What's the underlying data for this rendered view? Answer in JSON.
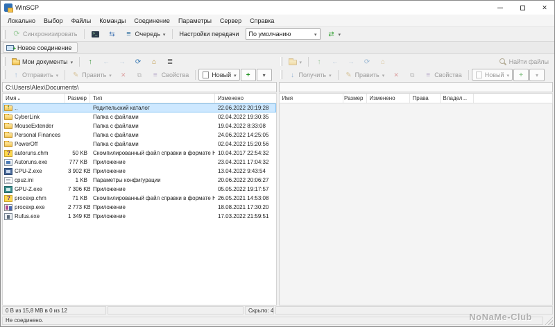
{
  "window": {
    "title": "WinSCP"
  },
  "menu": {
    "items": [
      "Локально",
      "Выбор",
      "Файлы",
      "Команды",
      "Соединение",
      "Параметры",
      "Сервер",
      "Справка"
    ]
  },
  "toolbar": {
    "synchronize": "Синхронизировать",
    "queue": "Очередь",
    "transfer_settings_label": "Настройки передачи",
    "transfer_preset": "По умолчанию"
  },
  "tabs": {
    "new_session": "Новое соединение"
  },
  "left": {
    "drive": "Мои документы",
    "upload": "Отправить",
    "edit": "Править",
    "properties": "Свойства",
    "new": "Новый",
    "address": "C:\\Users\\Alex\\Documents\\",
    "columns": {
      "name": "Имя",
      "size": "Размер",
      "type": "Тип",
      "modified": "Изменено"
    },
    "files": [
      {
        "name": "..",
        "size": "",
        "type": "Родительский каталог",
        "modified": "22.06.2022 20:19:28",
        "icon": "folder-up"
      },
      {
        "name": "CyberLink",
        "size": "",
        "type": "Папка с файлами",
        "modified": "02.04.2022 19:30:35",
        "icon": "folder"
      },
      {
        "name": "MouseExtender",
        "size": "",
        "type": "Папка с файлами",
        "modified": "19.04.2022 8:33:08",
        "icon": "folder"
      },
      {
        "name": "Personal Finances",
        "size": "",
        "type": "Папка с файлами",
        "modified": "24.06.2022 14:25:05",
        "icon": "folder"
      },
      {
        "name": "PowerOff",
        "size": "",
        "type": "Папка с файлами",
        "modified": "02.04.2022 15:20:56",
        "icon": "folder"
      },
      {
        "name": "autoruns.chm",
        "size": "50 KB",
        "type": "Скомпилированный файл справки в формате HTML",
        "modified": "10.04.2017 22:54:32",
        "icon": "chm"
      },
      {
        "name": "Autoruns.exe",
        "size": "777 KB",
        "type": "Приложение",
        "modified": "23.04.2021 17:04:32",
        "icon": "exe"
      },
      {
        "name": "CPU-Z.exe",
        "size": "3 902 KB",
        "type": "Приложение",
        "modified": "13.04.2022 9:43:54",
        "icon": "cpuz"
      },
      {
        "name": "cpuz.ini",
        "size": "1 KB",
        "type": "Параметры конфигурации",
        "modified": "20.06.2022 20:06:27",
        "icon": "ini"
      },
      {
        "name": "GPU-Z.exe",
        "size": "7 306 KB",
        "type": "Приложение",
        "modified": "05.05.2022 19:17:57",
        "icon": "gpuz"
      },
      {
        "name": "procexp.chm",
        "size": "71 KB",
        "type": "Скомпилированный файл справки в формате HTML",
        "modified": "26.05.2021 14:53:08",
        "icon": "chm"
      },
      {
        "name": "procexp.exe",
        "size": "2 773 KB",
        "type": "Приложение",
        "modified": "18.08.2021 17:30:20",
        "icon": "procexp"
      },
      {
        "name": "Rufus.exe",
        "size": "1 349 KB",
        "type": "Приложение",
        "modified": "17.03.2022 21:59:51",
        "icon": "rufus"
      }
    ],
    "status_size": "0 В из 15,8 МВ в 0 из 12",
    "status_hidden": "Скрыто: 4"
  },
  "right": {
    "download": "Получить",
    "edit": "Править",
    "properties": "Свойства",
    "new": "Новый",
    "find_files": "Найти файлы",
    "columns": {
      "name": "Имя",
      "size": "Размер",
      "modified": "Изменено",
      "rights": "Права",
      "owner": "Владел..."
    }
  },
  "status": {
    "connection": "Не соединено."
  },
  "watermark": "NoNaMe-Club"
}
